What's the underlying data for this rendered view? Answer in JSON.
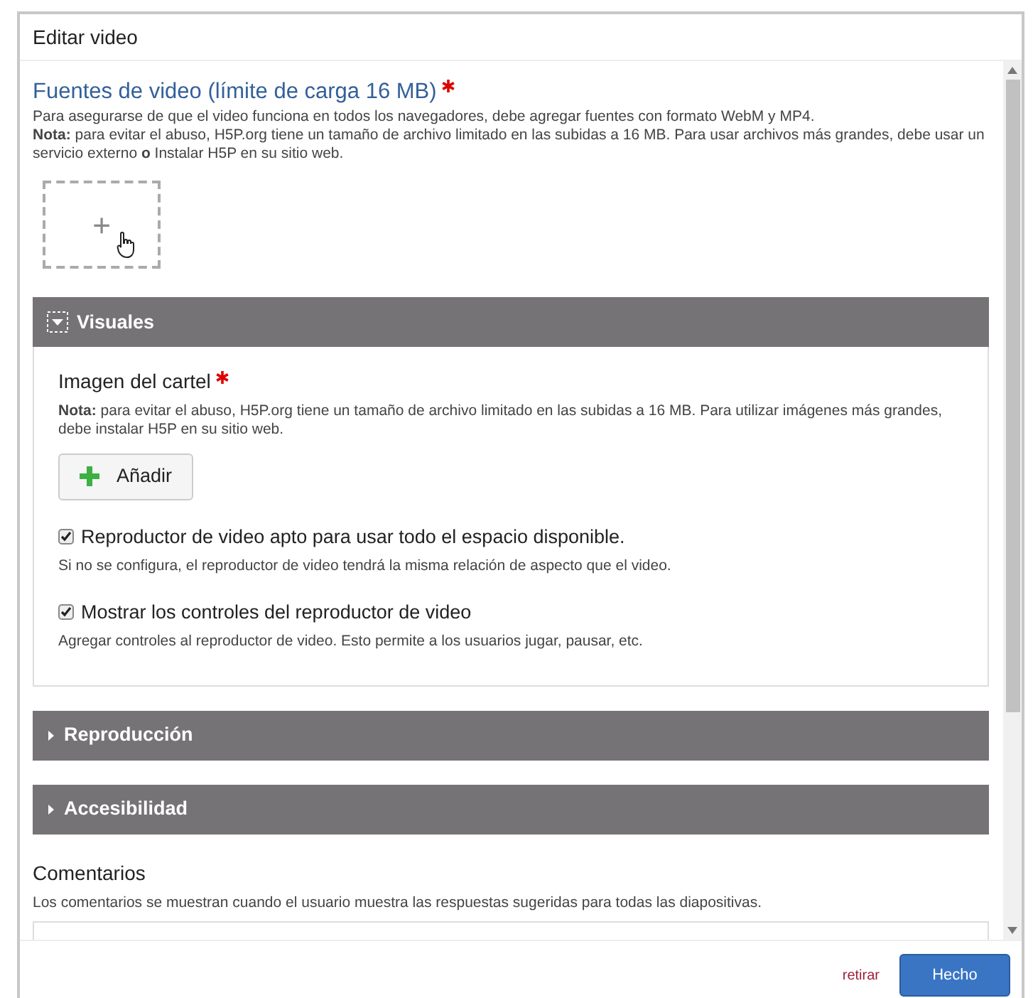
{
  "dialog": {
    "title": "Editar video"
  },
  "video_sources": {
    "label": "Fuentes de video (límite de carga 16 MB)",
    "required": true,
    "description": "Para asegurarse de que el video funciona en todos los navegadores, debe agregar fuentes con formato WebM y MP4.",
    "note": "**Nota:** para evitar el abuso, H5P.org tiene un tamaño de archivo limitado en las subidas a 16 MB. Para usar archivos más grandes, debe usar un servicio externo **o** Instalar H5P en su sitio web.",
    "add_symbol": "+"
  },
  "groups": [
    {
      "title": "Visuales",
      "expanded": true,
      "fields": [
        {
          "kind": "image",
          "label": "Imagen del cartel",
          "required": true,
          "note": "**Nota:** para evitar el abuso, H5P.org tiene un tamaño de archivo limitado en las subidas a 16 MB. Para utilizar imágenes más grandes, debe instalar H5P en su sitio web.",
          "button": "Añadir"
        },
        {
          "kind": "checkbox",
          "label": "Reproductor de video apto para usar todo el espacio disponible.",
          "checked": true,
          "description": "Si no se configura, el reproductor de video tendrá la misma relación de aspecto que el video."
        },
        {
          "kind": "checkbox",
          "label": "Mostrar los controles del reproductor de video",
          "checked": true,
          "description": "Agregar controles al reproductor de video. Esto permite a los usuarios jugar, pausar, etc."
        }
      ]
    },
    {
      "title": "Reproducción",
      "expanded": false
    },
    {
      "title": "Accesibilidad",
      "expanded": false
    }
  ],
  "comments": {
    "label": "Comentarios",
    "description": "Los comentarios se muestran cuando el usuario muestra las respuestas sugeridas para todas las diapositivas."
  },
  "footer": {
    "cancel": "retirar",
    "done": "Hecho"
  }
}
